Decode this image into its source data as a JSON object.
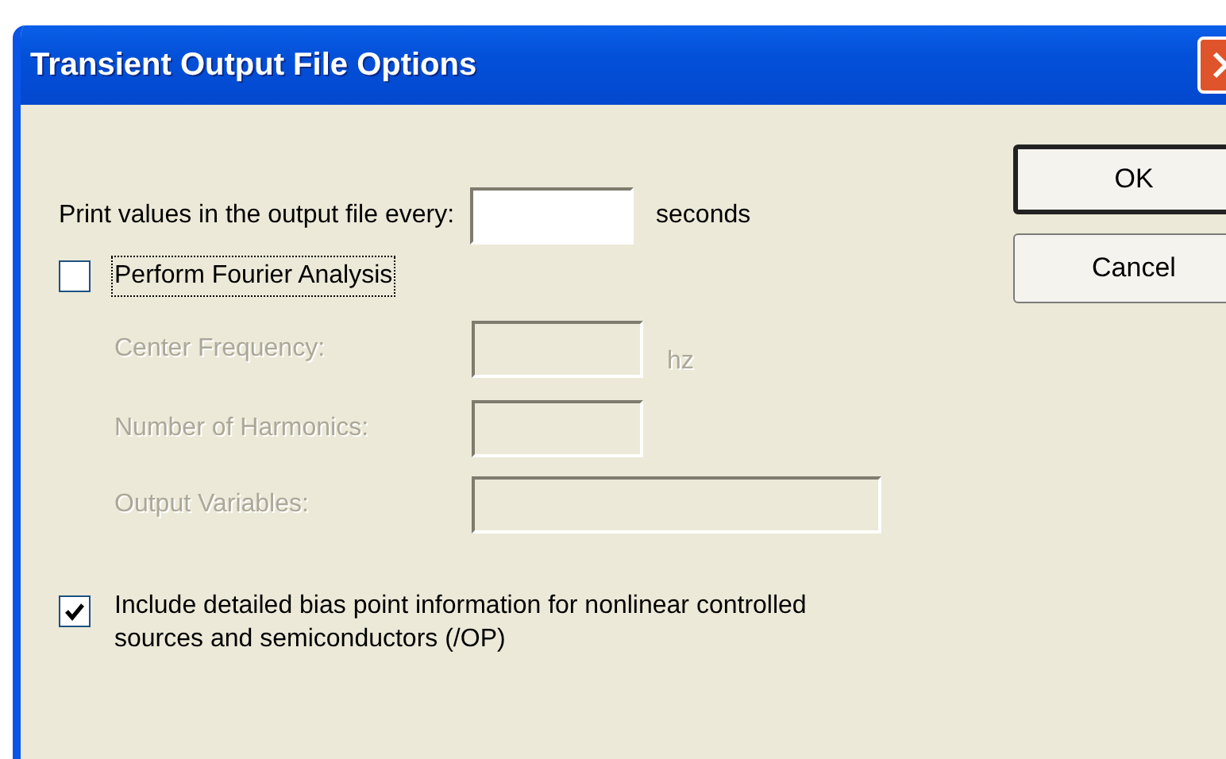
{
  "window": {
    "title": "Transient Output File Options"
  },
  "print_row": {
    "label": "Print values in the output file every:",
    "value_field": {
      "disabled": false
    },
    "unit": "seconds"
  },
  "fourier": {
    "label": "Perform Fourier Analysis",
    "checked": false,
    "focused": true
  },
  "fourier_fields": [
    {
      "label": "Center Frequency:",
      "unit": "hz",
      "kind": "short",
      "disabled": true
    },
    {
      "label": "Number of Harmonics:",
      "kind": "short",
      "disabled": true
    },
    {
      "label": "Output Variables:",
      "kind": "long",
      "disabled": true
    }
  ],
  "bias_point": {
    "label": "Include detailed bias point information for nonlinear controlled sources and semiconductors (/OP)",
    "checked": true
  },
  "buttons": [
    "OK",
    "Cancel"
  ]
}
